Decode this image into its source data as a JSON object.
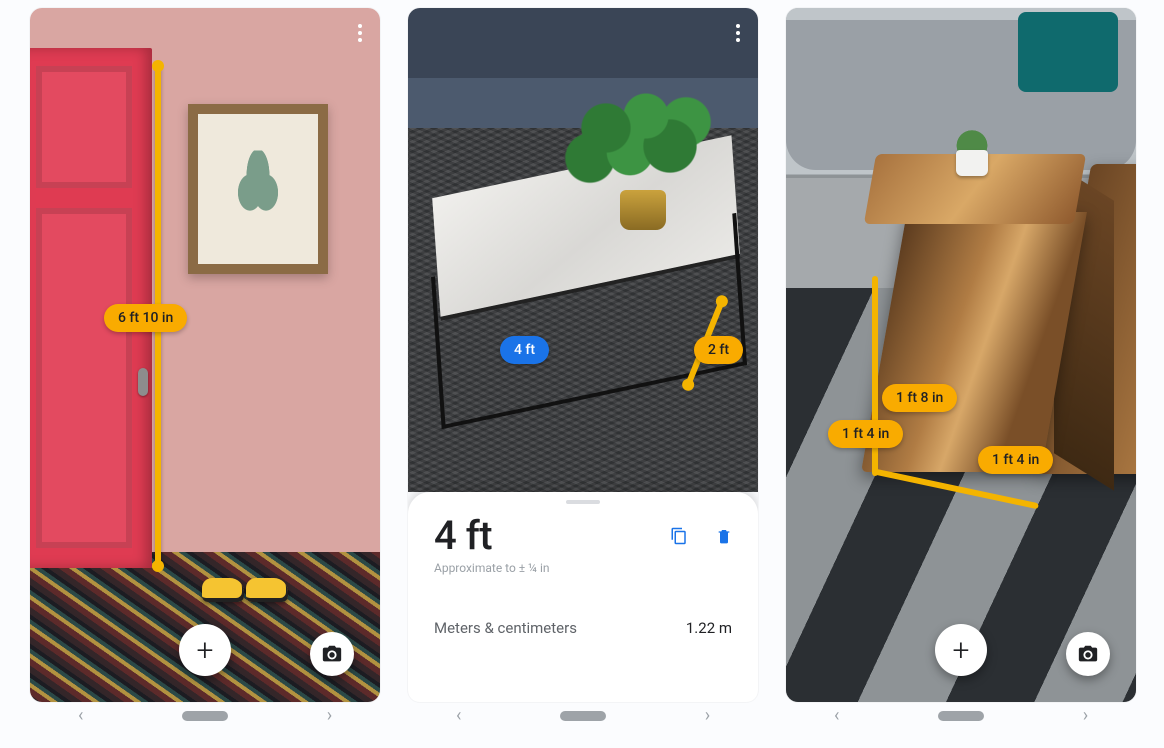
{
  "screens": {
    "door": {
      "measurement_label": "6 ft 10 in"
    },
    "table": {
      "length_label": "4 ft",
      "width_label": "2 ft",
      "sheet": {
        "value": "4 ft",
        "approx": "Approximate to ± ¼ in",
        "unit_row_label": "Meters & centimeters",
        "unit_row_value": "1.22 m"
      }
    },
    "stool": {
      "height_label": "1 ft 8 in",
      "width_label": "1 ft 4 in",
      "depth_label": "1 ft 4 in"
    }
  },
  "icons": {
    "add": "+"
  }
}
